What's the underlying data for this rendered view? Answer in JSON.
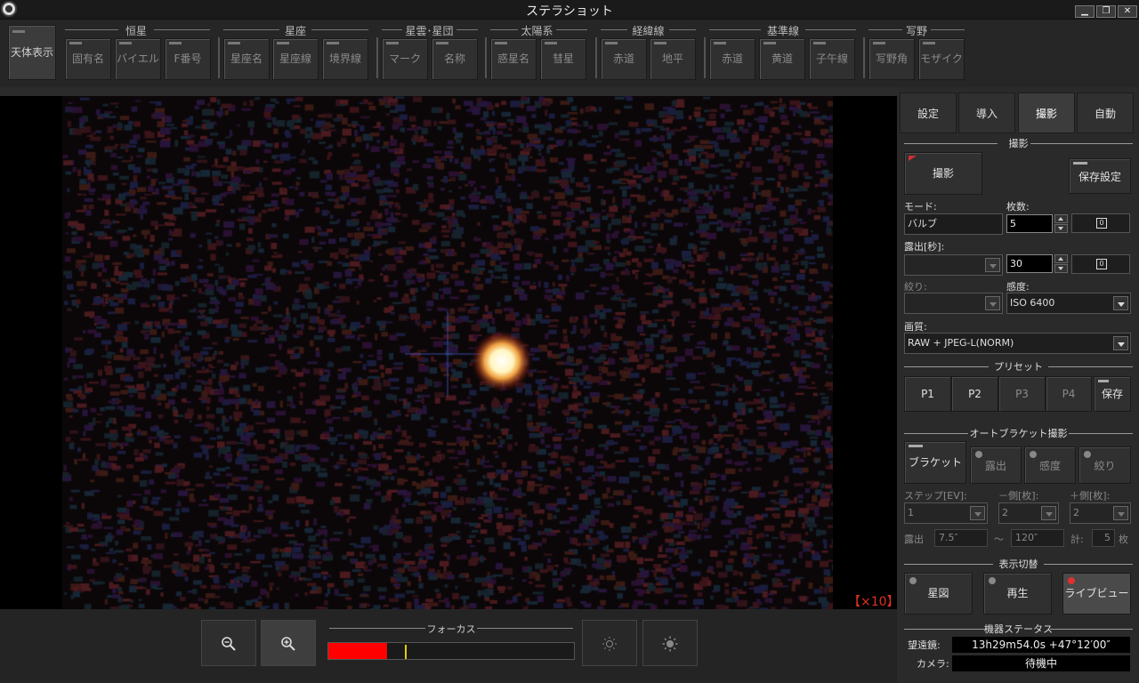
{
  "window": {
    "title": "ステラショット",
    "minimize": "▁",
    "restore": "❐",
    "close": "✕"
  },
  "toolbar": {
    "celestial_display": "天体表示",
    "groups": [
      {
        "label": "恒星",
        "buttons": [
          "固有名",
          "バイエル",
          "F番号"
        ]
      },
      {
        "label": "星座",
        "buttons": [
          "星座名",
          "星座線",
          "境界線"
        ]
      },
      {
        "label": "星雲･星団",
        "buttons": [
          "マーク",
          "名称"
        ]
      },
      {
        "label": "太陽系",
        "buttons": [
          "惑星名",
          "彗星"
        ]
      },
      {
        "label": "経緯線",
        "buttons": [
          "赤道",
          "地平"
        ]
      },
      {
        "label": "基準線",
        "buttons": [
          "赤道",
          "黄道",
          "子午線"
        ]
      },
      {
        "label": "写野",
        "buttons": [
          "写野角",
          "モザイク"
        ]
      }
    ]
  },
  "viewer": {
    "zoom_label": "【×10】"
  },
  "bottom": {
    "zoom_out_icon": "zoom-out-icon",
    "zoom_in_icon": "zoom-in-icon",
    "focus_label": "フォーカス",
    "focus_level": 0.24,
    "focus_marker": 0.31,
    "brightness_down_icon": "brightness-down-icon",
    "brightness_up_icon": "brightness-up-icon",
    "focus_color": "#ff0000"
  },
  "panel": {
    "tabs": [
      "設定",
      "導入",
      "撮影",
      "自動"
    ],
    "active_tab": "撮影",
    "capture": {
      "section": "撮影",
      "shoot_button": "撮影",
      "save_settings_button": "保存設定",
      "mode_label": "モード:",
      "mode_value": "バルブ",
      "count_label": "枚数:",
      "count_value": "5",
      "exposure_label": "露出[秒]:",
      "exposure_value": "30",
      "aperture_label": "絞り:",
      "iso_label": "感度:",
      "iso_value": "ISO 6400",
      "quality_label": "画質:",
      "quality_value": "RAW + JPEG-L(NORM)",
      "infinity_icon": "0"
    },
    "preset": {
      "section": "プリセット",
      "buttons": [
        "P1",
        "P2",
        "P3",
        "P4"
      ],
      "save": "保存"
    },
    "bracket": {
      "section": "オートブラケット撮影",
      "bracket_button": "ブラケット",
      "exposure_button": "露出",
      "iso_button": "感度",
      "aperture_button": "絞り",
      "step_label": "ステップ[EV]:",
      "step_value": "1",
      "minus_label": "－側[枚]:",
      "minus_value": "2",
      "plus_label": "＋側[枚]:",
      "plus_value": "2",
      "exposure_row_label": "露出",
      "exp_from": "7.5″",
      "tilde": "〜",
      "exp_to": "120″",
      "total_label": "計:",
      "total_value": "5",
      "unit": "枚"
    },
    "display": {
      "section": "表示切替",
      "starmap": "星図",
      "playback": "再生",
      "liveview": "ライブビュー"
    },
    "status": {
      "section": "機器ステータス",
      "telescope_label": "望遠鏡:",
      "telescope_value": "13h29m54.0s +47°12′00″",
      "camera_label": "カメラ:",
      "camera_value": "待機中"
    }
  }
}
